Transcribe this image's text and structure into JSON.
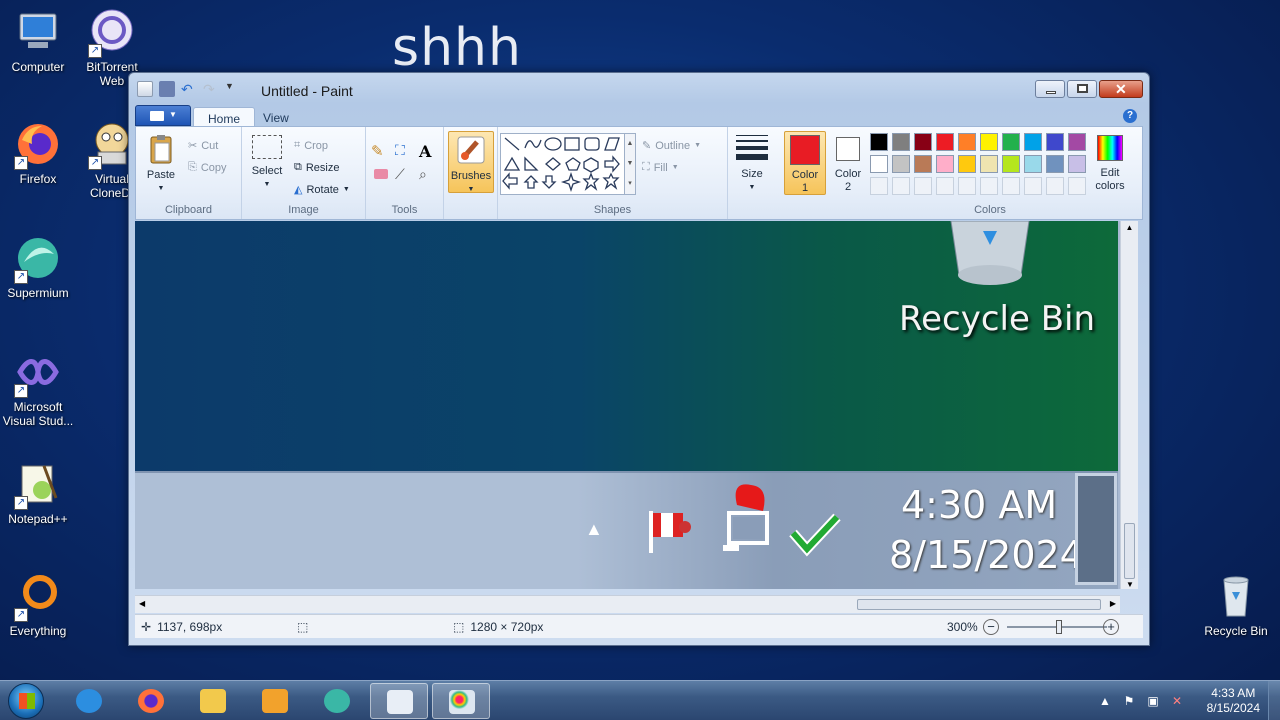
{
  "desktop": {
    "wallpaper_text": "shhh",
    "icons": [
      {
        "label": "Computer",
        "icon": "computer-icon"
      },
      {
        "label": "BitTorrent Web",
        "icon": "bittorrent-icon"
      },
      {
        "label": "Firefox",
        "icon": "firefox-icon"
      },
      {
        "label": "Virtual CloneDr",
        "icon": "clonedrive-icon"
      },
      {
        "label": "Supermium",
        "icon": "supermium-icon"
      },
      {
        "label": "Microsoft Visual Stud...",
        "icon": "visual-studio-icon"
      },
      {
        "label": "Notepad++",
        "icon": "notepadpp-icon"
      },
      {
        "label": "Everything",
        "icon": "everything-icon"
      },
      {
        "label": "Recycle Bin",
        "icon": "recycle-bin-icon"
      }
    ]
  },
  "window": {
    "title": "Untitled - Paint",
    "tabs": {
      "home": "Home",
      "view": "View"
    },
    "ribbon": {
      "clipboard": {
        "paste": "Paste",
        "cut": "Cut",
        "copy": "Copy",
        "label": "Clipboard"
      },
      "image": {
        "select": "Select",
        "crop": "Crop",
        "resize": "Resize",
        "rotate": "Rotate",
        "label": "Image"
      },
      "tools": {
        "label": "Tools"
      },
      "brushes": "Brushes",
      "shapes": {
        "outline": "Outline",
        "fill": "Fill",
        "label": "Shapes"
      },
      "size": "Size",
      "color1": {
        "line1": "Color",
        "line2": "1",
        "value": "#e81c24"
      },
      "color2": {
        "line1": "Color",
        "line2": "2",
        "value": "#ffffff"
      },
      "colors_label": "Colors",
      "edit_colors": {
        "line1": "Edit",
        "line2": "colors"
      },
      "palette": [
        "#000000",
        "#7f7f7f",
        "#880015",
        "#ed1c24",
        "#ff7f27",
        "#fff200",
        "#22b14c",
        "#00a2e8",
        "#3f48cc",
        "#a349a4",
        "#ffffff",
        "#c3c3c3",
        "#b97a57",
        "#ffaec9",
        "#ffc90e",
        "#efe4b0",
        "#b5e61d",
        "#99d9ea",
        "#7092be",
        "#c8bfe7"
      ]
    },
    "canvas": {
      "recycle_bin_label": "Recycle Bin",
      "time": "4:30 AM",
      "date": "8/15/2024"
    },
    "status": {
      "cursor_pos": "1137, 698px",
      "image_size": "1280 × 720px",
      "zoom": "300%"
    }
  },
  "taskbar": {
    "clock_time": "4:33 AM",
    "clock_date": "8/15/2024"
  }
}
